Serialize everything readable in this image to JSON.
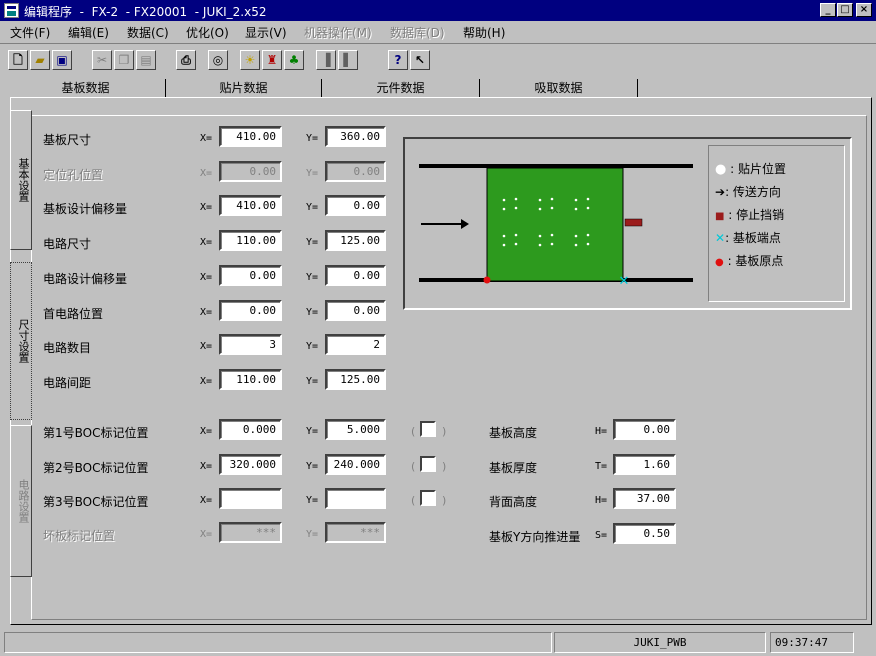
{
  "window": {
    "title": "编辑程序  -  FX-2  - FX20001  - JUKI_2.x52"
  },
  "menu": [
    {
      "label": "文件(F)",
      "enabled": true
    },
    {
      "label": "编辑(E)",
      "enabled": true
    },
    {
      "label": "数据(C)",
      "enabled": true
    },
    {
      "label": "优化(O)",
      "enabled": true
    },
    {
      "label": "显示(V)",
      "enabled": true
    },
    {
      "label": "机器操作(M)",
      "enabled": false
    },
    {
      "label": "数据库(D)",
      "enabled": false
    },
    {
      "label": "帮助(H)",
      "enabled": true
    }
  ],
  "tabs": [
    "基板数据",
    "贴片数据",
    "元件数据",
    "吸取数据"
  ],
  "side_tabs": [
    "基本设置",
    "尺寸设置",
    "电路设置"
  ],
  "rows": [
    {
      "label": "基板尺寸",
      "x": "410.00",
      "y": "360.00",
      "enabled": true
    },
    {
      "label": "定位孔位置",
      "x": "0.00",
      "y": "0.00",
      "enabled": false
    },
    {
      "label": "基板设计偏移量",
      "x": "410.00",
      "y": "0.00",
      "enabled": true
    },
    {
      "label": "电路尺寸",
      "x": "110.00",
      "y": "125.00",
      "enabled": true
    },
    {
      "label": "电路设计偏移量",
      "x": "0.00",
      "y": "0.00",
      "enabled": true
    },
    {
      "label": "首电路位置",
      "x": "0.00",
      "y": "0.00",
      "enabled": true
    },
    {
      "label": "电路数目",
      "x": "3",
      "y": "2",
      "enabled": true
    },
    {
      "label": "电路间距",
      "x": "110.00",
      "y": "125.00",
      "enabled": true
    }
  ],
  "boc": [
    {
      "label": "第1号BOC标记位置",
      "x": "0.000",
      "y": "5.000"
    },
    {
      "label": "第2号BOC标记位置",
      "x": "320.000",
      "y": "240.000"
    },
    {
      "label": "第3号BOC标记位置",
      "x": "",
      "y": ""
    }
  ],
  "bad_mark": {
    "label": "坏板标记位置",
    "x": "***",
    "y": "***"
  },
  "x_prefix": "X=",
  "y_prefix": "Y=",
  "right_fields": [
    {
      "label": "基板高度",
      "prefix": "H=",
      "value": "0.00"
    },
    {
      "label": "基板厚度",
      "prefix": "T=",
      "value": "1.60"
    },
    {
      "label": "背面高度",
      "prefix": "H=",
      "value": "37.00"
    },
    {
      "label": "基板Y方向推进量",
      "prefix": "S=",
      "value": "0.50"
    }
  ],
  "legend": [
    {
      "icon": "white-dot",
      "label": ": 贴片位置"
    },
    {
      "icon": "arrow",
      "label": ": 传送方向"
    },
    {
      "icon": "red-square",
      "label": ": 停止挡销"
    },
    {
      "icon": "cyan-x",
      "label": ": 基板端点"
    },
    {
      "icon": "red-dot",
      "label": ": 基板原点"
    }
  ],
  "colors": {
    "board": "#2d9a1e",
    "titlebar": "#000080",
    "stopper": "#9b1c1c",
    "endpoint": "#00c8d8",
    "origin": "#e01010"
  },
  "status": {
    "machine": "JUKI_PWB",
    "time": "09:37:47"
  }
}
